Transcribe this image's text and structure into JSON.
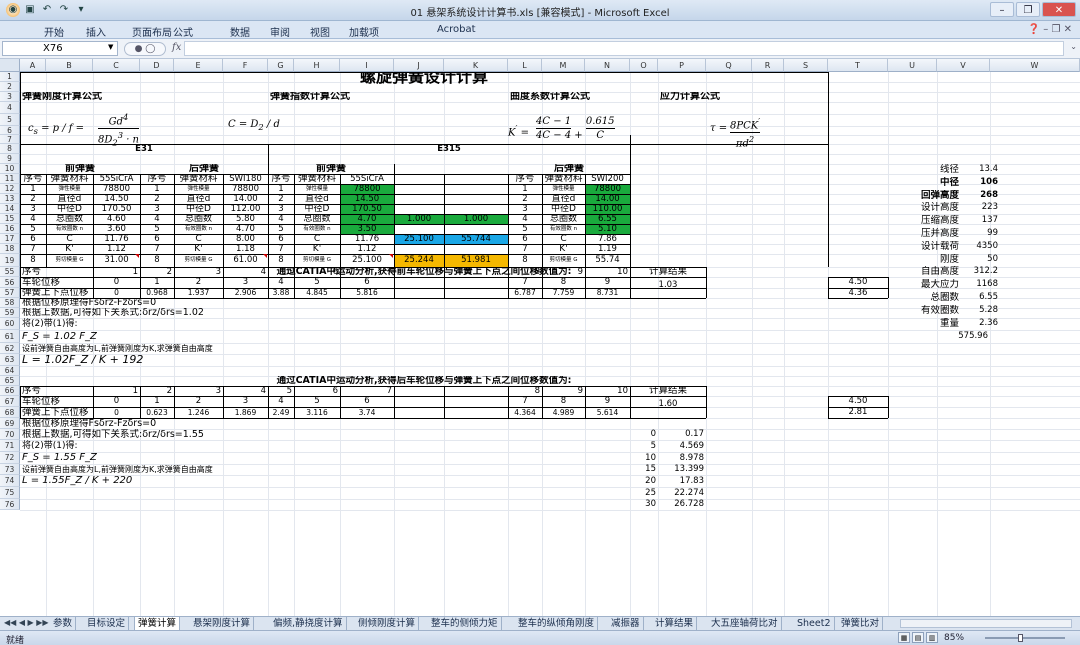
{
  "window": {
    "title": "01 悬架系统设计计算书.xls  [兼容模式] - Microsoft Excel"
  },
  "ribbon_tabs": [
    "开始",
    "插入",
    "页面布局",
    "公式",
    "数据",
    "审阅",
    "视图",
    "加载项",
    "Acrobat"
  ],
  "formula_bar": {
    "name_box": "X76",
    "formula": ""
  },
  "col_headers": [
    "A",
    "B",
    "C",
    "D",
    "E",
    "F",
    "G",
    "H",
    "I",
    "J",
    "K",
    "L",
    "M",
    "N",
    "O",
    "P",
    "Q",
    "R",
    "S",
    "T",
    "U",
    "V",
    "W"
  ],
  "row_headers": [
    "1",
    "2",
    "3",
    "4",
    "5",
    "6",
    "7",
    "8",
    "9",
    "10",
    "11",
    "12",
    "13",
    "14",
    "15",
    "16",
    "17",
    "18",
    "19",
    "55",
    "56",
    "57",
    "58",
    "59",
    "60",
    "61",
    "62",
    "63",
    "64",
    "65",
    "66",
    "67",
    "68",
    "69",
    "70",
    "71",
    "72",
    "73",
    "74",
    "75",
    "76"
  ],
  "sheet": {
    "title": "螺旋弹簧设计计算",
    "sec_stiffness": "弹簧刚度计算公式",
    "sec_index": "弹簧指数计算公式",
    "sec_curv": "曲度系数计算公式",
    "sec_stress": "应力计算公式",
    "e31": "E31",
    "e315": "E315",
    "front": "前弹簧",
    "rear": "后弹簧",
    "hdr_no": "序号",
    "hdr_mat": "弹簧材料",
    "mat_55": "55SiCrA",
    "mat_swi180": "SWI180",
    "mat_swi200": "SWI200",
    "params": [
      "弹性模量",
      "直径d",
      "中径D",
      "总圈数",
      "有效圈数 n",
      "C",
      "K'",
      "剪切模量 G"
    ],
    "e31_front": [
      "78800",
      "14.50",
      "170.50",
      "4.60",
      "3.60",
      "11.76",
      "1.12",
      "31.00"
    ],
    "e31_rear": [
      "78800",
      "14.00",
      "112.00",
      "5.80",
      "4.70",
      "8.00",
      "1.18",
      "61.00"
    ],
    "e315_front": [
      "78800",
      "14.50",
      "170.50",
      "4.70",
      "3.50",
      "11.76",
      "1.12",
      "25.100"
    ],
    "e315_rear": [
      "78800",
      "14.00",
      "110.00",
      "6.55",
      "5.10",
      "7.86",
      "1.19",
      "55.74"
    ],
    "e315_extra": {
      "j15": "1.000",
      "k15": "1.000",
      "j17": "25.100",
      "k17": "55.744",
      "j19": "25.244",
      "k19": "51.981"
    },
    "right_params": [
      {
        "label": "线径",
        "value": "13.4",
        "bold": false
      },
      {
        "label": "中径",
        "value": "106",
        "bold": true
      },
      {
        "label": "回弹高度",
        "value": "268",
        "bold": true
      },
      {
        "label": "设计高度",
        "value": "223",
        "bold": false
      },
      {
        "label": "压缩高度",
        "value": "137",
        "bold": false
      },
      {
        "label": "压并高度",
        "value": "99",
        "bold": false
      },
      {
        "label": "设计载荷",
        "value": "4350",
        "bold": false
      },
      {
        "label": "刚度",
        "value": "50",
        "bold": false
      },
      {
        "label": "自由高度",
        "value": "312.2",
        "bold": false
      },
      {
        "label": "最大应力",
        "value": "1168",
        "bold": false
      },
      {
        "label": "总圈数",
        "value": "6.55",
        "bold": false
      },
      {
        "label": "有效圈数",
        "value": "5.28",
        "bold": false
      },
      {
        "label": "重量",
        "value": "2.36",
        "bold": false
      }
    ],
    "w61": "575.96",
    "front_analysis_title": "通过CATIA中运动分析,获得前车轮位移与弹簧上下点之间位移数值为:",
    "rear_analysis_title": "通过CATIA中运动分析,获得后车轮位移与弹簧上下点之间位移数值为:",
    "lbl_no": "序号",
    "lbl_wheel": "车轮位移",
    "lbl_spring": "弹簧上下点位移",
    "lbl_result": "计算结果",
    "t1_nums": [
      "1",
      "2",
      "3",
      "4",
      "5",
      "6",
      "7",
      "8",
      "9",
      "10"
    ],
    "t1_wheel": [
      "0",
      "1",
      "2",
      "3",
      "4",
      "5",
      "6",
      "7",
      "8",
      "9"
    ],
    "t1_spring": [
      "0",
      "0.968",
      "1.937",
      "2.906",
      "3.88",
      "4.845",
      "5.816",
      "6.787",
      "7.759",
      "8.731"
    ],
    "t1_result": "1.03",
    "t1_t56": "4.50",
    "t1_t57": "4.36",
    "t2_nums": [
      "1",
      "2",
      "3",
      "4",
      "5",
      "6",
      "7",
      "8",
      "9",
      "10"
    ],
    "t2_wheel": [
      "0",
      "1",
      "2",
      "3",
      "4",
      "5",
      "6",
      "7",
      "8",
      "9"
    ],
    "t2_spring": [
      "0",
      "0.623",
      "1.246",
      "1.869",
      "2.49",
      "3.116",
      "3.74",
      "4.364",
      "4.989",
      "5.614"
    ],
    "t2_result": "1.60",
    "t2_t67": "4.50",
    "t2_t68": "2.81",
    "r58": "根据位移原理得Fsδrz-Fzδrs=0",
    "r59": "根据上数据,可得如下关系式:δrz/δrs=1.02",
    "r60": "将(2)带(1)得:",
    "r61": "F_S = 1.02 F_Z",
    "r62": "设前弹簧自由高度为L,前弹簧刚度为K,求弹簧自由高度",
    "r63": "L = 1.02F_Z / K + 192",
    "r69": "根据位移原理得Fsδrz-Fzδrs=0",
    "r70": "根据上数据,可得如下关系式:δrz/δrs=1.55",
    "r71": "将(2)带(1)得:",
    "r72": "F_S = 1.55 F_Z",
    "r73": "设前弹簧自由高度为L,前弹簧刚度为K,求弹簧自由高度",
    "r74": "L = 1.55F_Z / K + 220",
    "op_pairs": [
      [
        "0",
        "0.17"
      ],
      [
        "5",
        "4.569"
      ],
      [
        "10",
        "8.978"
      ],
      [
        "15",
        "13.399"
      ],
      [
        "20",
        "17.83"
      ],
      [
        "25",
        "22.274"
      ],
      [
        "30",
        "26.728"
      ]
    ]
  },
  "sheet_tabs": [
    "参数",
    "目标设定",
    "弹簧计算",
    "悬架刚度计算",
    "偏频,静挠度计算",
    "侧倾刚度计算",
    "整车的侧倾力矩",
    "整车的纵倾角刚度",
    "减振器",
    "计算结果",
    "大五座轴荷比对",
    "Sheet2",
    "弹簧比对"
  ],
  "active_tab": "弹簧计算",
  "status": {
    "mode": "就绪",
    "zoom": "85%"
  }
}
